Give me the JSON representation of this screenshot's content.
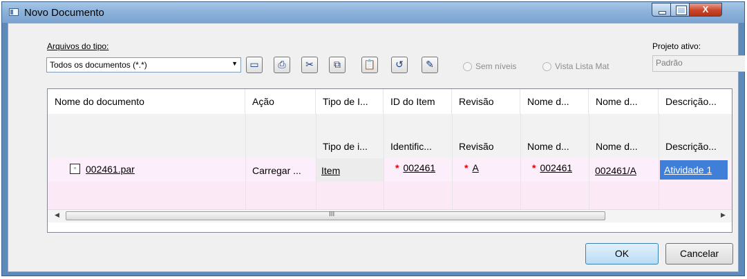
{
  "window": {
    "title": "Novo Documento"
  },
  "file_type": {
    "label": "Arquivos do tipo:",
    "selected": "Todos os documentos (*.*)"
  },
  "toolbar": [
    "save-icon",
    "print-icon",
    "cut-icon",
    "copy-icon",
    "paste-icon",
    "undo-icon",
    "edit-icon"
  ],
  "options": {
    "sem_niveis": "Sem níveis",
    "vista_lista_mat": "Vista Lista Mat"
  },
  "project": {
    "label": "Projeto ativo:",
    "value": "Padrão"
  },
  "grid": {
    "columns": [
      "Nome do documento",
      "Ação",
      "Tipo de I...",
      "ID do Item",
      "Revisão",
      "Nome d...",
      "Nome d...",
      "Descrição..."
    ],
    "subheader": [
      "",
      "",
      "Tipo de i...",
      "Identific...",
      "Revisão",
      "Nome d...",
      "Nome d...",
      "Descrição..."
    ],
    "row": {
      "name": "002461.par",
      "action": "Carregar ...",
      "type": "Item",
      "item_id": "002461",
      "revision": "A",
      "name_d1": "002461",
      "name_d2": "002461/A",
      "description": "Atividade 1"
    },
    "scroll_grip": "III"
  },
  "buttons": {
    "ok": "OK",
    "cancel": "Cancelar"
  }
}
